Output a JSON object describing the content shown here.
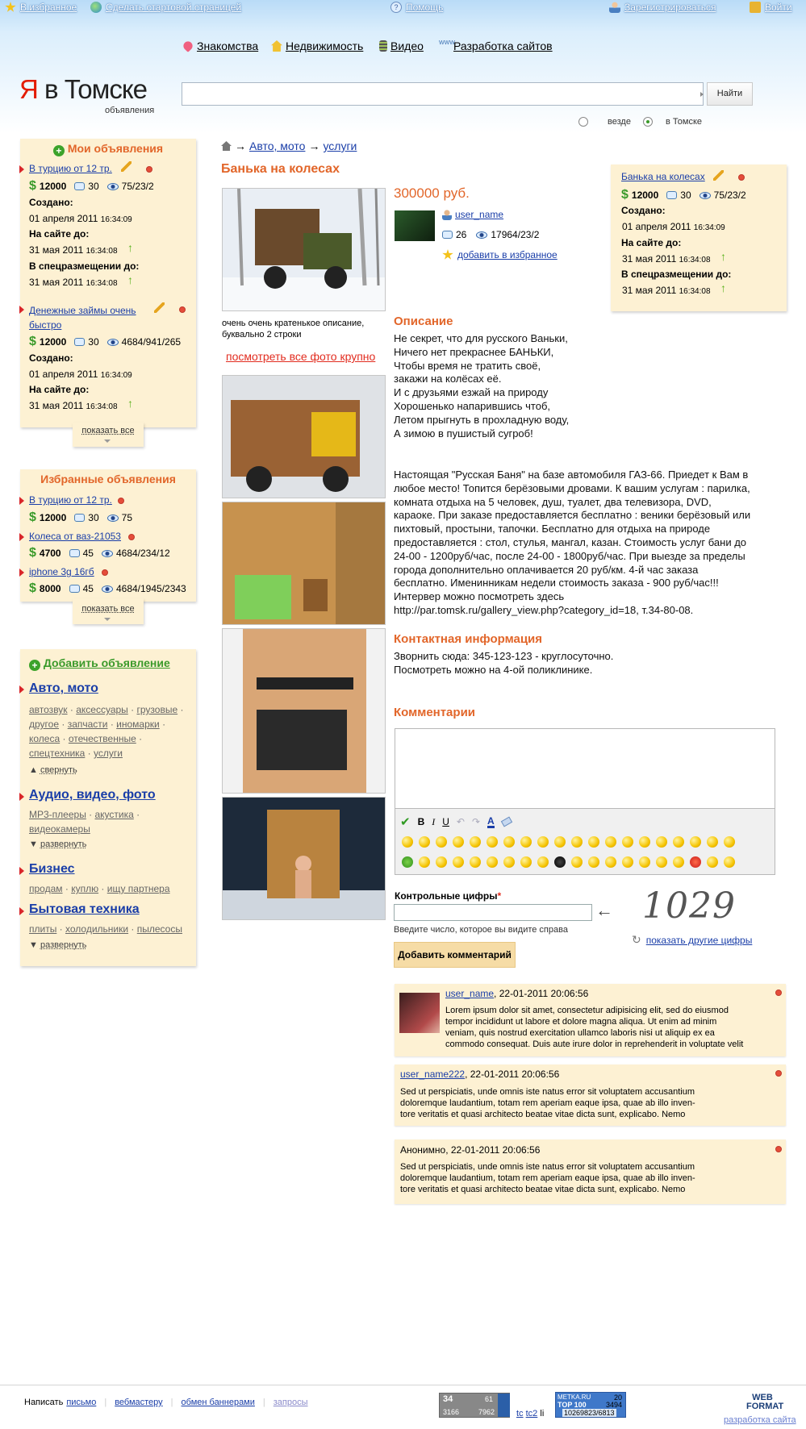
{
  "top": {
    "favorites": "В избранное",
    "homepage": "Сделать стартовой страницей",
    "help": "Помощь",
    "register": "Зарегистрироваться",
    "login": "Войти"
  },
  "categories": [
    "Знакомства",
    "Недвижимость",
    "Видео",
    "Разработка сайтов"
  ],
  "logo": {
    "ya": "Я",
    "rest": " в Томске",
    "sub": "объявления"
  },
  "search": {
    "button": "Найти",
    "value": "",
    "scope_all": "везде",
    "scope_city": "в Томске"
  },
  "my_ads": {
    "title": "Мои объявления",
    "items": [
      {
        "title": "В турцию от 12 тр.",
        "price": "12000",
        "comments": "30",
        "views": "75/23/2",
        "created_label": "Создано:",
        "created": "01 апреля 2011",
        "created_time": "16:34:09",
        "until_label": "На сайте до:",
        "until": "31 мая 2011",
        "until_time": "16:34:08",
        "special_label": "В спецразмещении до:",
        "special": "31 мая 2011",
        "special_time": "16:34:08"
      },
      {
        "title": "Денежные займы очень быстро",
        "price": "12000",
        "comments": "30",
        "views": "4684/941/265",
        "created_label": "Создано:",
        "created": "01 апреля 2011",
        "created_time": "16:34:09",
        "until_label": "На сайте до:",
        "until": "31 мая 2011",
        "until_time": "16:34:08"
      }
    ],
    "show_all": "показать все"
  },
  "fav_ads": {
    "title": "Избранные объявления",
    "items": [
      {
        "title": "В турцию от 12 тр.",
        "price": "12000",
        "comments": "30",
        "views": "75"
      },
      {
        "title": "Колеса от ваз-21053",
        "price": "4700",
        "comments": "45",
        "views": "4684/234/12"
      },
      {
        "title": "iphone 3g 16гб",
        "price": "8000",
        "comments": "45",
        "views": "4684/1945/2343"
      }
    ],
    "show_all": "показать все"
  },
  "add_ad": {
    "title": "Добавить объявление",
    "sections": [
      {
        "title": "Авто, мото",
        "subs": [
          "автозвук",
          "аксессуары",
          "грузовые",
          "другое",
          "запчасти",
          "иномарки",
          "колеса",
          "отечественные",
          "спецтехника",
          "услуги"
        ],
        "toggle": "свернуть"
      },
      {
        "title": "Аудио, видео, фото",
        "subs": [
          "MP3-плееры",
          "акустика",
          "видеокамеры"
        ],
        "toggle": "развернуть"
      },
      {
        "title": "Бизнес",
        "subs": [
          "продам",
          "куплю",
          "ищу партнера"
        ]
      },
      {
        "title": "Бытовая техника",
        "subs": [
          "плиты",
          "холодильники",
          "пылесосы"
        ],
        "toggle": "развернуть"
      }
    ]
  },
  "breadcrumb": {
    "arrow": "→",
    "items": [
      "Авто, мото",
      "услуги"
    ]
  },
  "ad": {
    "title": "Банька на колесах",
    "price": "300000 руб.",
    "user": "user_name",
    "comments": "26",
    "views": "17964/23/2",
    "add_fav": "добавить в избранное",
    "photo_caption": "очень очень кратенькое описание,  буквально 2 строки",
    "see_all_photos": "посмотреть все фото крупно",
    "desc_heading": "Описание",
    "poem": [
      "Не секрет, что для русского Ваньки,",
      "Ничего нет прекраснее БАНЬКИ,",
      "Чтобы время не тратить своё,",
      "закажи на колёсах её.",
      "И с друзьями езжай на природу",
      "Хорошенько напарившись чтоб,",
      "Летом прыгнуть в прохладную воду,",
      "А зимою в пушистый сугроб!"
    ],
    "body": [
      "Настоящая \"Русская Баня\" на базе автомобиля ГАЗ-66. Приедет к Вам в",
      "любое место! Топится берёзовыми дровами. К вашим услугам : парилка,",
      "комната отдыха на 5 человек, душ, туалет, два телевизора, DVD,",
      "караоке. При заказе предоставляется бесплатно : веники берёзовый или",
      "пихтовый, простыни, тапочки. Бесплатно для отдыха на природе",
      "предоставляется : стол, стулья, мангал, казан. Стоимость услуг бани до",
      "24-00 - 1200руб/час, после 24-00 - 1800руб/час. При выезде за пределы",
      "города дополнительно оплачивается 20 руб/км. 4-й час заказа",
      "бесплатно. Именинникам недели стоимость заказа - 900 руб/час!!!",
      "Интервер можно посмотреть здесь",
      "http://par.tomsk.ru/gallery_view.php?category_id=18, т.34-80-08."
    ],
    "contact_heading": "Контактная информация",
    "contact": [
      "Зворнить сюда: 345-123-123 - круглосуточно.",
      "Посмотреть можно на 4-ой поликлинике."
    ]
  },
  "summary": {
    "title": "Банька на колесах",
    "price": "12000",
    "comments": "30",
    "views": "75/23/2",
    "created_label": "Создано:",
    "created": "01 апреля 2011",
    "created_time": "16:34:09",
    "until_label": "На сайте до:",
    "until": "31 мая 2011",
    "until_time": "16:34:08",
    "special_label": "В спецразмещении до:",
    "special": "31 мая 2011",
    "special_time": "16:34:08"
  },
  "comments_section": {
    "heading": "Комментарии",
    "editor_bold": "B",
    "editor_italic": "I",
    "editor_underline": "U",
    "editor_color": "A",
    "captcha_label": "Контрольные цифры",
    "captcha_required": "*",
    "captcha_hint": "Введите число, которое вы видите справа",
    "captcha_digits": "1029",
    "captcha_other": "показать другие цифры",
    "submit": "Добавить комментарий",
    "items": [
      {
        "user": "user_name",
        "date": ", 22-01-2011 20:06:56",
        "lines": [
          "Lorem ipsum dolor sit amet, consectetur adipisicing elit, sed do eiusmod",
          "tempor incididunt ut labore et dolore magna aliqua. Ut enim ad minim",
          "veniam, quis nostrud exercitation ullamco laboris nisi ut aliquip ex ea",
          "commodo consequat. Duis aute irure dolor in reprehenderit in voluptate velit"
        ]
      },
      {
        "user": "user_name222",
        "date": ", 22-01-2011 20:06:56",
        "lines": [
          "Sed ut perspiciatis, unde omnis iste natus error sit voluptatem accusantium",
          "doloremque laudantium, totam rem aperiam eaque ipsa, quae ab illo inven-",
          "tore veritatis et quasi architecto beatae vitae dicta sunt, explicabo. Nemo"
        ]
      },
      {
        "user": "Анонимно",
        "date": ", 22-01-2011 20:06:56",
        "lines": [
          "Sed ut perspiciatis, unde omnis iste natus error sit voluptatem accusantium",
          "doloremque laudantium, totam rem aperiam eaque ipsa, quae ab illo inven-",
          "tore veritatis et quasi architecto beatae vitae dicta sunt, explicabo. Nemo"
        ]
      }
    ]
  },
  "footer": {
    "write": "Написать",
    "links": [
      "письмо",
      "вебмастеру",
      "обмен баннерами",
      "запросы"
    ],
    "counter1_a": "34",
    "counter1_b": "61",
    "counter1_c": "3166",
    "counter1_d": "7962",
    "tc": "tc",
    "tc2": "tc2",
    "li": "li",
    "metrika_name": "METKA.RU",
    "metrika_a": "20",
    "metrika_top": "TOP 100",
    "metrika_b": "3494",
    "metrika_c": "10269823/6813",
    "webformat": "WEB FORMAT",
    "dev": "разработка сайта"
  }
}
